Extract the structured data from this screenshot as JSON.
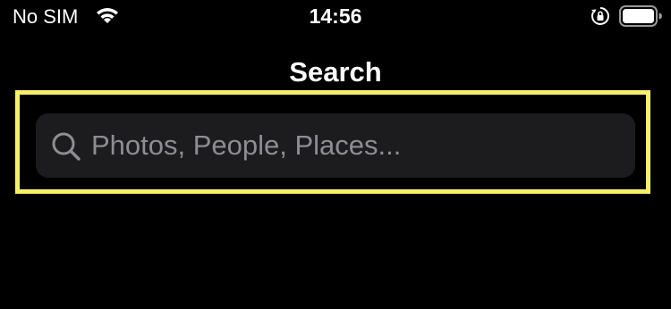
{
  "status_bar": {
    "carrier": "No SIM",
    "time": "14:56",
    "icons": [
      "wifi-icon",
      "orientation-lock-icon",
      "battery-icon"
    ]
  },
  "navigation": {
    "title": "Search"
  },
  "search": {
    "placeholder": "Photos, People, Places...",
    "icon": "search-icon"
  },
  "colors": {
    "background": "#000000",
    "search_field": "#1c1c1e",
    "placeholder_text": "#8d8d93",
    "highlight": "#f6f06a",
    "text": "#ffffff"
  }
}
